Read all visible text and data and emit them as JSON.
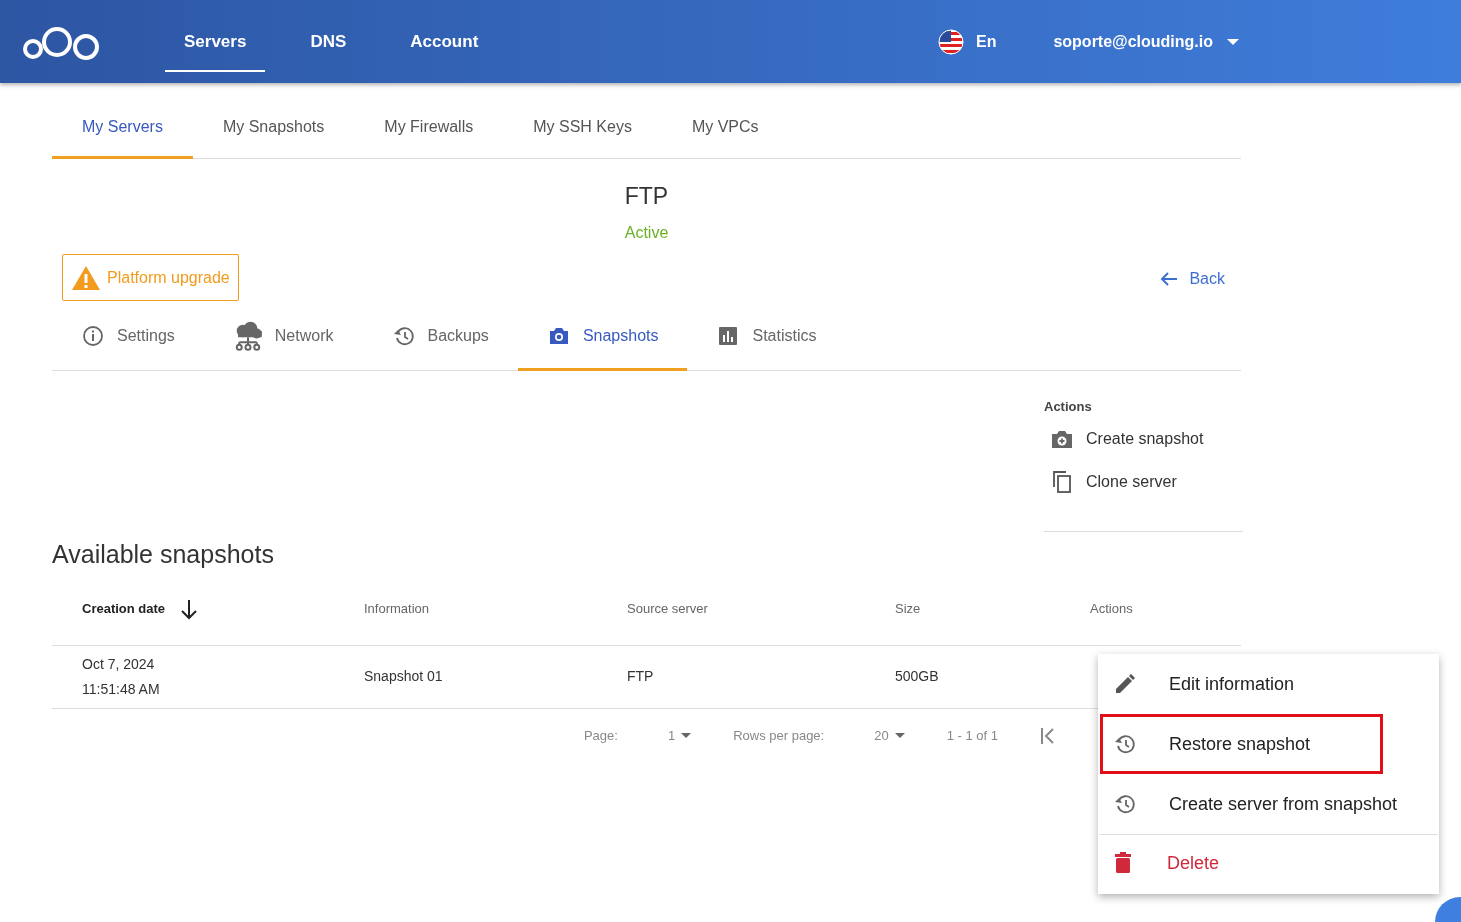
{
  "header": {
    "nav": [
      {
        "label": "Servers",
        "selected": true
      },
      {
        "label": "DNS",
        "selected": false
      },
      {
        "label": "Account",
        "selected": false
      }
    ],
    "language": "En",
    "user": "soporte@clouding.io"
  },
  "subnav": [
    {
      "label": "My Servers",
      "selected": true
    },
    {
      "label": "My Snapshots",
      "selected": false
    },
    {
      "label": "My Firewalls",
      "selected": false
    },
    {
      "label": "My SSH Keys",
      "selected": false
    },
    {
      "label": "My VPCs",
      "selected": false
    }
  ],
  "server": {
    "name": "FTP",
    "status": "Active"
  },
  "upgrade_button": "Platform upgrade",
  "back_link": "Back",
  "tabs": [
    {
      "label": "Settings",
      "kind": "info",
      "selected": false
    },
    {
      "label": "Network",
      "kind": "network",
      "selected": false
    },
    {
      "label": "Backups",
      "kind": "history",
      "selected": false
    },
    {
      "label": "Snapshots",
      "kind": "camera",
      "selected": true
    },
    {
      "label": "Statistics",
      "kind": "chart",
      "selected": false
    }
  ],
  "actions": {
    "title": "Actions",
    "items": [
      {
        "label": "Create snapshot",
        "kind": "camera-plus"
      },
      {
        "label": "Clone server",
        "kind": "copy"
      }
    ]
  },
  "snapshots": {
    "title": "Available snapshots",
    "columns": [
      {
        "label": "Creation date",
        "sorted": true
      },
      {
        "label": "Information",
        "sorted": false
      },
      {
        "label": "Source server",
        "sorted": false
      },
      {
        "label": "Size",
        "sorted": false
      },
      {
        "label": "Actions",
        "sorted": false
      }
    ],
    "rows": [
      {
        "date": "Oct 7, 2024",
        "time": "11:51:48 AM",
        "information": "Snapshot 01",
        "source": "FTP",
        "size": "500GB"
      }
    ],
    "pagination": {
      "page_label": "Page:",
      "page": "1",
      "rows_label": "Rows per page:",
      "rows": "20",
      "range": "1 - 1 of 1"
    }
  },
  "menu": [
    {
      "label": "Edit information",
      "kind": "pencil",
      "outlined": false
    },
    {
      "label": "Restore snapshot",
      "kind": "history",
      "outlined": true
    },
    {
      "label": "Create server from snapshot",
      "kind": "history",
      "outlined": false
    },
    {
      "label": "Delete",
      "kind": "trash",
      "outlined": false
    }
  ]
}
